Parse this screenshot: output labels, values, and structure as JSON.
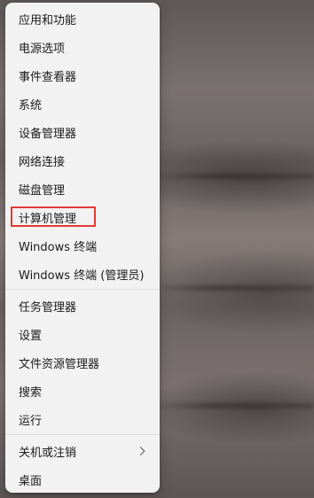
{
  "menu": {
    "groups": [
      {
        "items": [
          {
            "label": "应用和功能"
          },
          {
            "label": "电源选项"
          },
          {
            "label": "事件查看器"
          },
          {
            "label": "系统"
          },
          {
            "label": "设备管理器"
          },
          {
            "label": "网络连接"
          },
          {
            "label": "磁盘管理"
          },
          {
            "label": "计算机管理",
            "highlighted": true
          },
          {
            "label": "Windows 终端"
          },
          {
            "label": "Windows 终端 (管理员)"
          }
        ]
      },
      {
        "items": [
          {
            "label": "任务管理器"
          },
          {
            "label": "设置"
          },
          {
            "label": "文件资源管理器"
          },
          {
            "label": "搜索"
          },
          {
            "label": "运行"
          }
        ]
      },
      {
        "items": [
          {
            "label": "关机或注销",
            "has_submenu": true,
            "submenu_icon": "chevron-right-icon"
          },
          {
            "label": "桌面"
          }
        ]
      }
    ]
  },
  "colors": {
    "menu_background": "#f2f2f2",
    "highlight_border": "#e53935",
    "text": "#1b1b1b"
  }
}
